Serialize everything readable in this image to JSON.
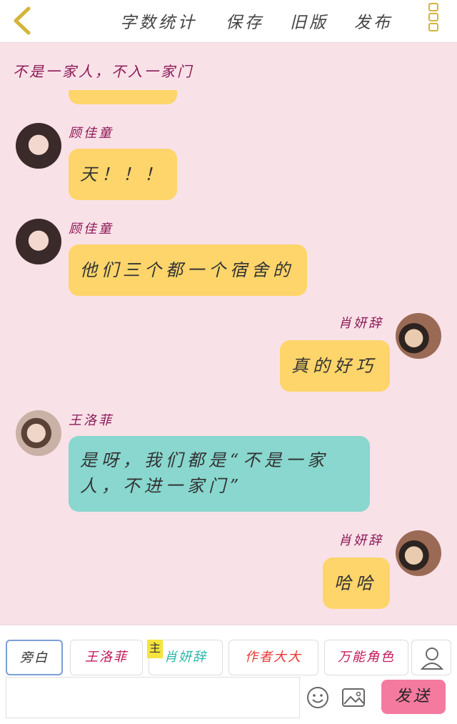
{
  "header": {
    "actions": [
      "字数统计",
      "保存",
      "旧版",
      "发布"
    ]
  },
  "chat": {
    "title": "不是一家人，不入一家门",
    "messages": [
      {
        "sender": "顾佳童",
        "text": "天！！！"
      },
      {
        "sender": "顾佳童",
        "text": "他们三个都一个宿舍的"
      },
      {
        "sender": "肖妍辞",
        "text": "真的好巧"
      },
      {
        "sender": "王洛菲",
        "text": "是呀，我们都是“不是一家人，不进一家门”",
        "line1": "是呀，我们都是“不是一家",
        "line2": "人，不进一家门”"
      },
      {
        "sender": "肖妍辞",
        "text": "哈哈"
      }
    ]
  },
  "toolbar": {
    "roles": [
      {
        "label": "旁白"
      },
      {
        "label": "王洛菲"
      },
      {
        "label": "肖妍辞",
        "tag": "主"
      },
      {
        "label": "作者大大"
      },
      {
        "label": "万能角色"
      }
    ],
    "input_placeholder": "",
    "send_label": "发送"
  },
  "colors": {
    "background": "#f9e1e8",
    "name_color": "#8b1a56",
    "bubble_yellow": "#fdd56b",
    "bubble_teal": "#89d7cf",
    "send_button": "#f57aa0",
    "role_narration": "#333333",
    "role_wangluofei": "#c2185b",
    "role_xiaoyanci": "#2bb5a8",
    "role_author": "#e53935",
    "role_universal": "#c2185b"
  },
  "icons": [
    "back-icon",
    "menu-icon",
    "person-icon",
    "emoji-icon",
    "image-icon"
  ]
}
